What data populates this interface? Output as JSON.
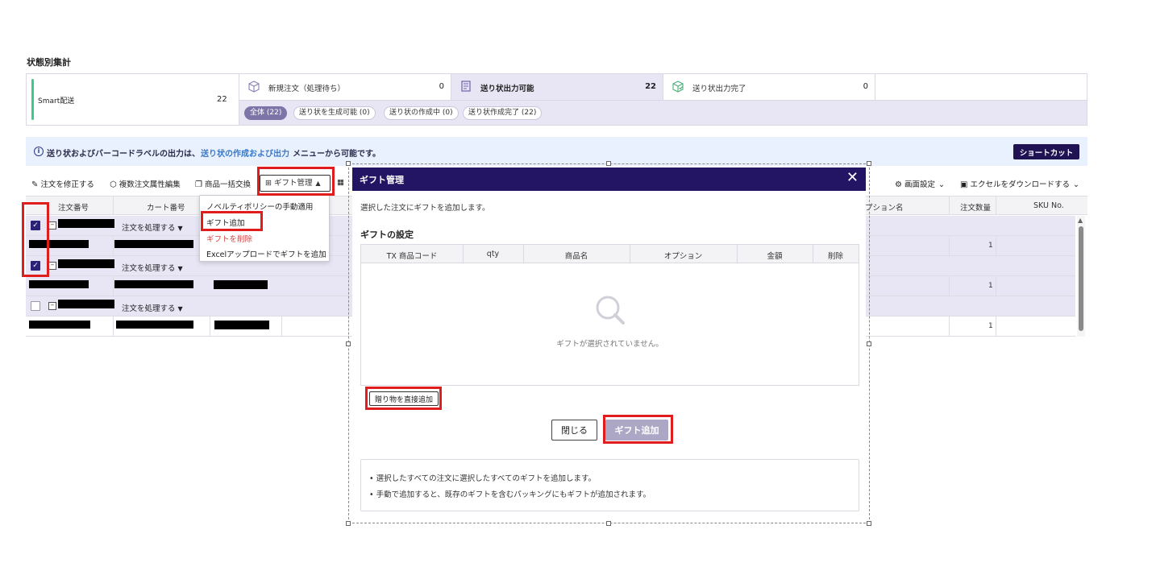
{
  "section_title": "状態別集計",
  "summary": {
    "smart_label": "Smart配送",
    "smart_count": "22",
    "stats": [
      {
        "label": "新規注文（処理待ち）",
        "count": "0",
        "icon": "box-icon"
      },
      {
        "label": "送り状出力可能",
        "count": "22",
        "icon": "label-print-icon"
      },
      {
        "label": "送り状出力完了",
        "count": "0",
        "icon": "box-check-icon"
      }
    ],
    "filters": [
      "全体 (22)",
      "送り状を生成可能 (0)",
      "送り状の作成中 (0)",
      "送り状作成完了 (22)"
    ]
  },
  "banner": {
    "text1": "送り状およびバーコードラベルの出力は、",
    "link": "送り状の作成および出力",
    "text2": "メニューから可能です。",
    "shortcut": "ショートカット"
  },
  "toolbar": {
    "edit_order": "注文を修正する",
    "bulk_attr": "複数注文属性編集",
    "bulk_exchange": "商品一括交換",
    "gift_manage": "ギフト管理",
    "screen_settings": "画面設定",
    "download_excel": "エクセルをダウンロードする"
  },
  "table": {
    "headers": {
      "order_no": "注文番号",
      "cart_no": "カート番号",
      "option_name": "プション名",
      "order_qty": "注文数量",
      "sku": "SKU No."
    },
    "process_label": "注文を処理する",
    "rows": [
      {
        "checked": true,
        "qty": "1"
      },
      {
        "checked": true,
        "qty": "1"
      },
      {
        "checked": false,
        "qty": "1"
      }
    ]
  },
  "menu": {
    "items": [
      "ノベルティポリシーの手動適用",
      "ギフト追加",
      "ギフトを削除",
      "Excelアップロードでギフトを追加"
    ]
  },
  "modal": {
    "title": "ギフト管理",
    "close_glyph": "✕",
    "description": "選択した注文にギフトを追加します。",
    "subtitle": "ギフトの設定",
    "columns": [
      "TX 商品コード",
      "qty",
      "商品名",
      "オプション",
      "金額",
      "削除"
    ],
    "empty": "ギフトが選択されていません。",
    "direct_add": "贈り物を直接追加",
    "close": "閉じる",
    "add": "ギフト追加",
    "notes": [
      "選択したすべての注文に選択したすべてのギフトを追加します。",
      "手動で追加すると、既存のギフトを含むパッキングにもギフトが追加されます。"
    ]
  },
  "colors": {
    "header_navy": "#231563",
    "highlight": "#e8e6f5",
    "accent_red": "#e01c1c",
    "link_blue": "#3a78c9"
  }
}
